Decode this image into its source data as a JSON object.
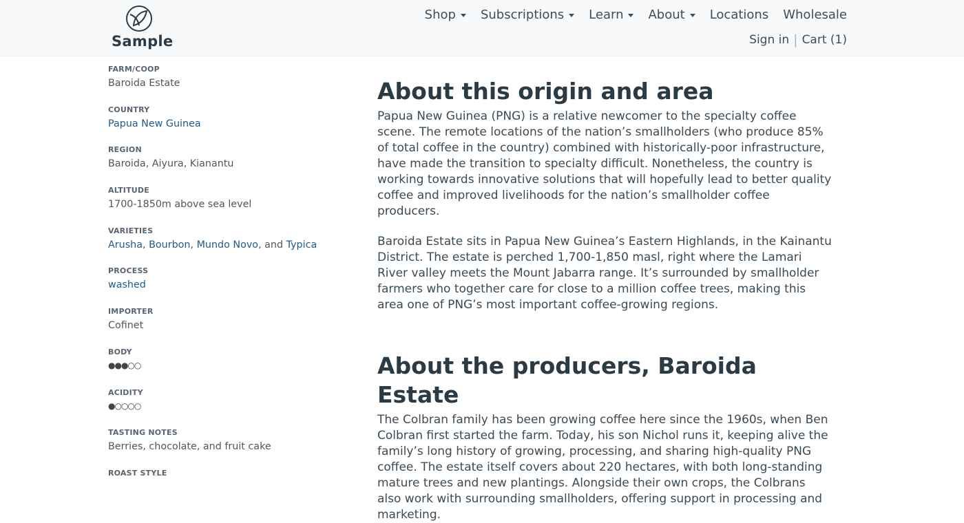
{
  "header": {
    "logo_text": "Sample",
    "nav": [
      {
        "label": "Shop",
        "dropdown": true
      },
      {
        "label": "Subscriptions",
        "dropdown": true
      },
      {
        "label": "Learn",
        "dropdown": true
      },
      {
        "label": "About",
        "dropdown": true
      },
      {
        "label": "Locations",
        "dropdown": false
      },
      {
        "label": "Wholesale",
        "dropdown": false
      }
    ],
    "sign_in": "Sign in",
    "separator": "|",
    "cart": "Cart (1)"
  },
  "sidebar": {
    "farm": {
      "label": "FARM/COOP",
      "value": "Baroida Estate"
    },
    "country": {
      "label": "COUNTRY",
      "value": "Papua New Guinea"
    },
    "region": {
      "label": "REGION",
      "value": "Baroida, Aiyura, Kianantu"
    },
    "altitude": {
      "label": "ALTITUDE",
      "value": "1700-1850m above sea level"
    },
    "varieties": {
      "label": "VARIETIES",
      "items": [
        "Arusha",
        "Bourbon",
        "Mundo Novo",
        "Typica"
      ],
      "sep1": ", ",
      "sep2": ", ",
      "sep3": ", and "
    },
    "process": {
      "label": "PROCESS",
      "value": "washed"
    },
    "importer": {
      "label": "IMPORTER",
      "value": "Cofinet"
    },
    "body": {
      "label": "BODY",
      "level": 3,
      "max": 5,
      "dots": "●●●○○"
    },
    "acidity": {
      "label": "ACIDITY",
      "level": 1,
      "max": 5,
      "dots": "●○○○○"
    },
    "tasting": {
      "label": "TASTING NOTES",
      "value": "Berries, chocolate, and fruit cake"
    },
    "roast": {
      "label": "ROAST STYLE"
    }
  },
  "main": {
    "origin_title": "About this origin and area",
    "origin_p1": "Papua New Guinea (PNG) is a relative newcomer to the specialty coffee scene. The remote locations of the nation’s smallholders (who produce 85% of total coffee in the country) combined with historically-poor infrastructure, have made the transition to specialty difficult. Nonetheless, the country is working towards innovative solutions that will hopefully lead to better quality coffee and improved livelihoods for the nation’s smallholder coffee producers.",
    "origin_p2": "Baroida Estate sits in Papua New Guinea’s Eastern Highlands, in the Kainantu District. The estate is perched 1,700-1,850 masl, right where the Lamari River valley meets the Mount Jabarra range. It’s surrounded by smallholder farmers who together care for close to a million coffee trees, making this area one of PNG’s most important coffee-growing regions.",
    "producers_title": "About the producers, Baroida Estate",
    "producers_p1": "The Colbran family has been growing coffee here since the 1960s, when Ben Colbran first started the farm. Today, his son Nichol runs it, keeping alive the family’s long history of growing, processing, and sharing high-quality PNG coffee. The estate itself covers about 220 hectares, with both long-standing mature trees and new plantings. Alongside their own crops, the Colbrans also work with surrounding smallholders, offering support in processing and marketing."
  },
  "colors": {
    "link": "#1e5a8c",
    "heading": "#2b3b45",
    "header_bg": "#f8f9fa"
  }
}
